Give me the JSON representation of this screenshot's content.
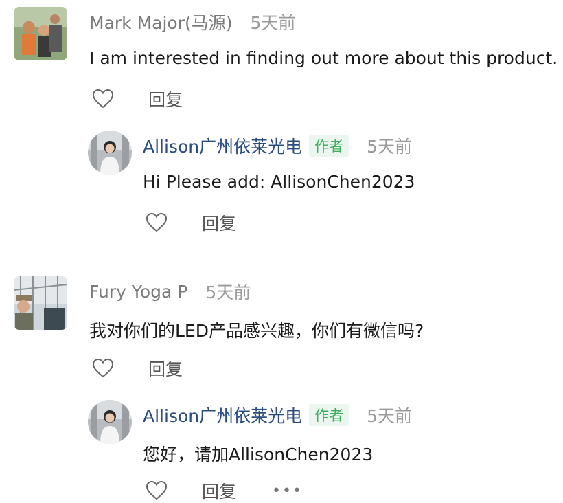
{
  "comments": [
    {
      "user": "Mark Major(马源)",
      "time": "5天前",
      "text": "I am interested in finding out more about this product.",
      "reply_label": "回复",
      "reply": {
        "user": "Allison广州依莱光电",
        "badge": "作者",
        "time": "5天前",
        "text": "Hi Please add: AllisonChen2023",
        "reply_label": "回复"
      }
    },
    {
      "user": "Fury Yoga P",
      "time": "5天前",
      "text": "我对你们的LED产品感兴趣，你们有微信吗?",
      "reply_label": "回复",
      "reply": {
        "user": "Allison广州依莱光电",
        "badge": "作者",
        "time": "5天前",
        "text": "您好，请加AllisonChen2023",
        "reply_label": "回复",
        "more_label": "•••"
      }
    }
  ],
  "icons": {
    "like": "heart-outline-icon",
    "more": "more-dots-icon"
  },
  "colors": {
    "author_name": "#2b4c7e",
    "badge_bg": "#eaf6ee",
    "badge_text": "#3fae5e",
    "muted": "#9a9a9a"
  }
}
